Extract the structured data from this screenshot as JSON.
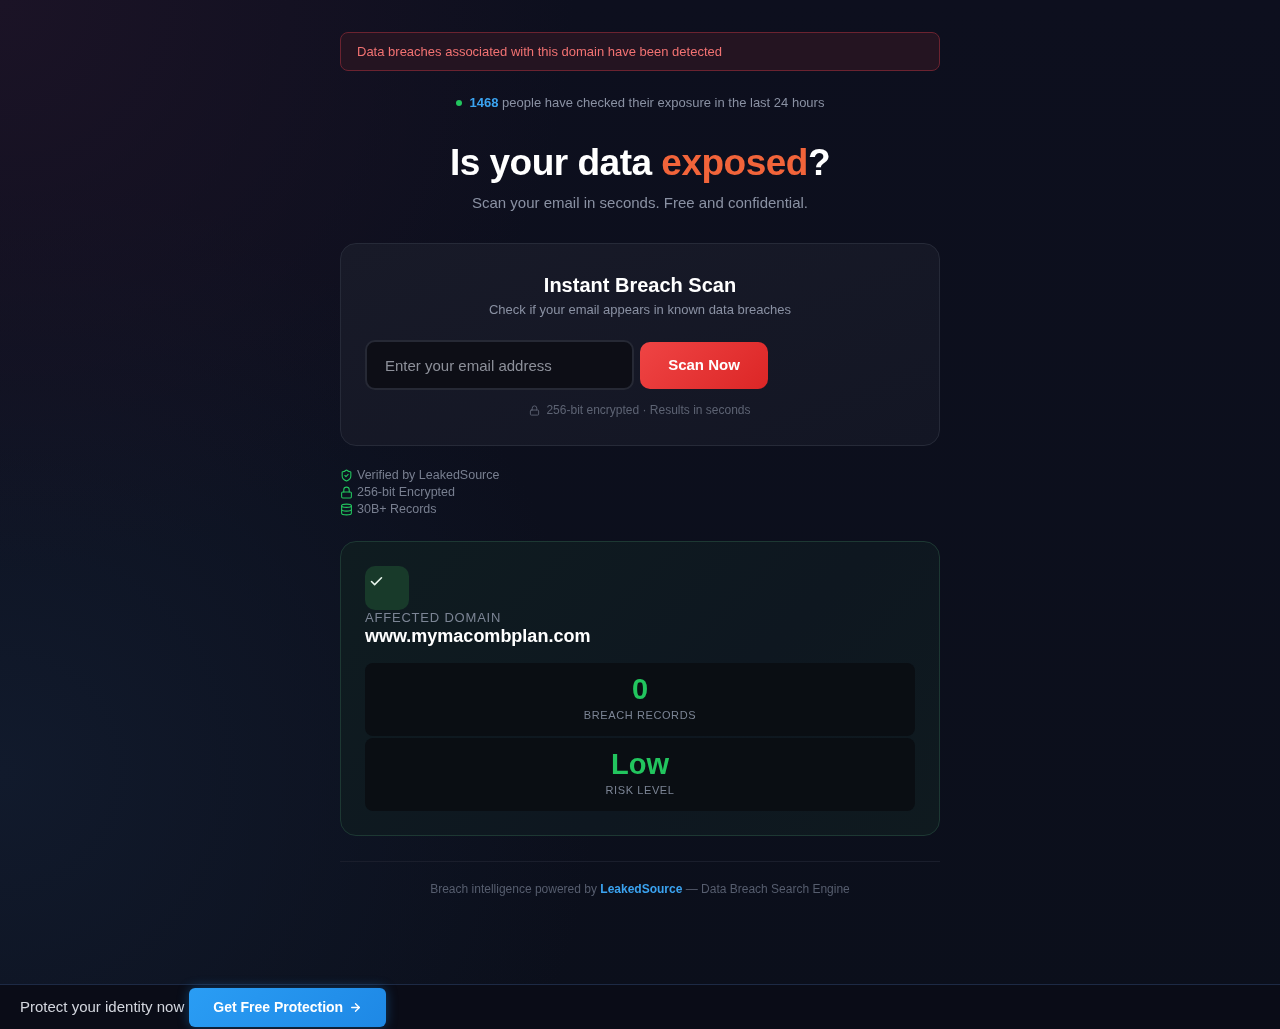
{
  "alert": {
    "text": "Data breaches associated with this domain have been detected"
  },
  "activity": {
    "count": "1468",
    "text": "people have checked their exposure in the last 24 hours"
  },
  "hero": {
    "title_start": "Is your data",
    "title_highlight": "exposed",
    "title_end": "?",
    "subtitle": "Scan your email in seconds. Free and confidential."
  },
  "scan_card": {
    "title": "Instant Breach Scan",
    "subtitle": "Check if your email appears in known data breaches",
    "email_field": {
      "placeholder": "Enter your email address"
    },
    "button": "Scan Now",
    "security_note": "256-bit encrypted · Results in seconds"
  },
  "trust_badges": [
    {
      "label": "Verified by LeakedSource"
    },
    {
      "label": "256-bit Encrypted"
    },
    {
      "label": "30B+ Records"
    }
  ],
  "result": {
    "label": "AFFECTED DOMAIN",
    "domain": "www.mymacombplan.com",
    "stats": [
      {
        "value": "0",
        "label": "BREACH RECORDS"
      },
      {
        "value": "Low",
        "label": "RISK LEVEL"
      }
    ]
  },
  "footer": {
    "text_start": "Breach intelligence powered by",
    "link": "LeakedSource",
    "text_end": "— Data Breach Search Engine"
  },
  "bottom_bar": {
    "text": "Protect your identity now",
    "button": "Get Free Protection"
  }
}
